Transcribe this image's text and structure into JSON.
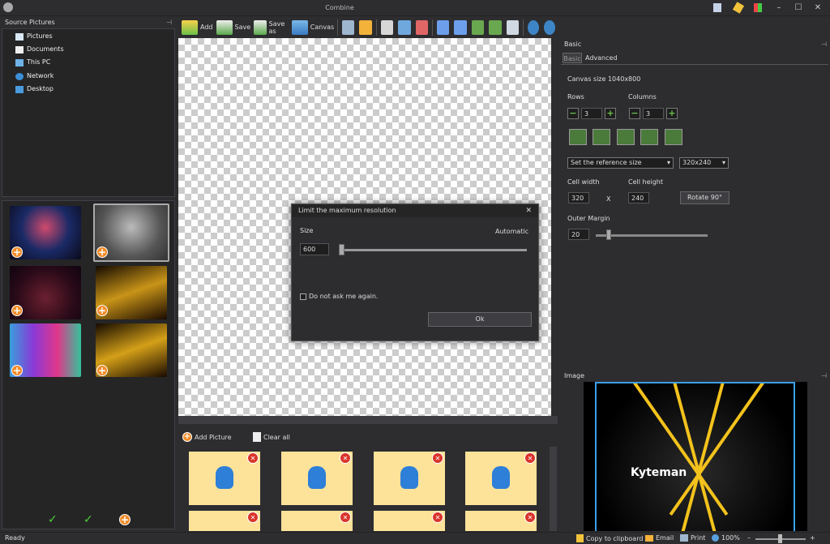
{
  "window": {
    "title": "Combine"
  },
  "source_panel": {
    "title": "Source Pictures",
    "tree": [
      "Pictures",
      "Documents",
      "This PC",
      "Network",
      "Desktop"
    ]
  },
  "toolbar": {
    "add": "Add",
    "save": "Save",
    "save_as": "Save as",
    "canvas": "Canvas"
  },
  "dialog": {
    "title": "Limit the maximum resolution",
    "size_label": "Size",
    "auto_label": "Automatic",
    "size_value": "600",
    "checkbox_label": "Do not ask me again.",
    "ok": "Ok"
  },
  "cells_bar": {
    "add_picture": "Add Picture",
    "clear_all": "Clear all"
  },
  "basic_panel": {
    "title": "Basic",
    "tabs": [
      "Basic",
      "Advanced"
    ],
    "canvas_size": "Canvas size 1040x800",
    "rows_label": "Rows",
    "rows_value": "3",
    "columns_label": "Columns",
    "columns_value": "3",
    "reference_select": "Set the reference size",
    "size_select": "320x240",
    "cell_width_label": "Cell width",
    "cell_width_value": "320",
    "x_label": "X",
    "cell_height_label": "Cell height",
    "cell_height_value": "240",
    "rotate_btn": "Rotate 90°",
    "outer_margin_label": "Outer Margin",
    "outer_margin_value": "20"
  },
  "image_panel": {
    "title": "Image",
    "image_text": "Kyteman"
  },
  "status": {
    "ready": "Ready",
    "copy": "Copy to clipboard",
    "email": "Email",
    "print": "Print",
    "zoom": "100%",
    "minus": "–",
    "plus": "+"
  }
}
